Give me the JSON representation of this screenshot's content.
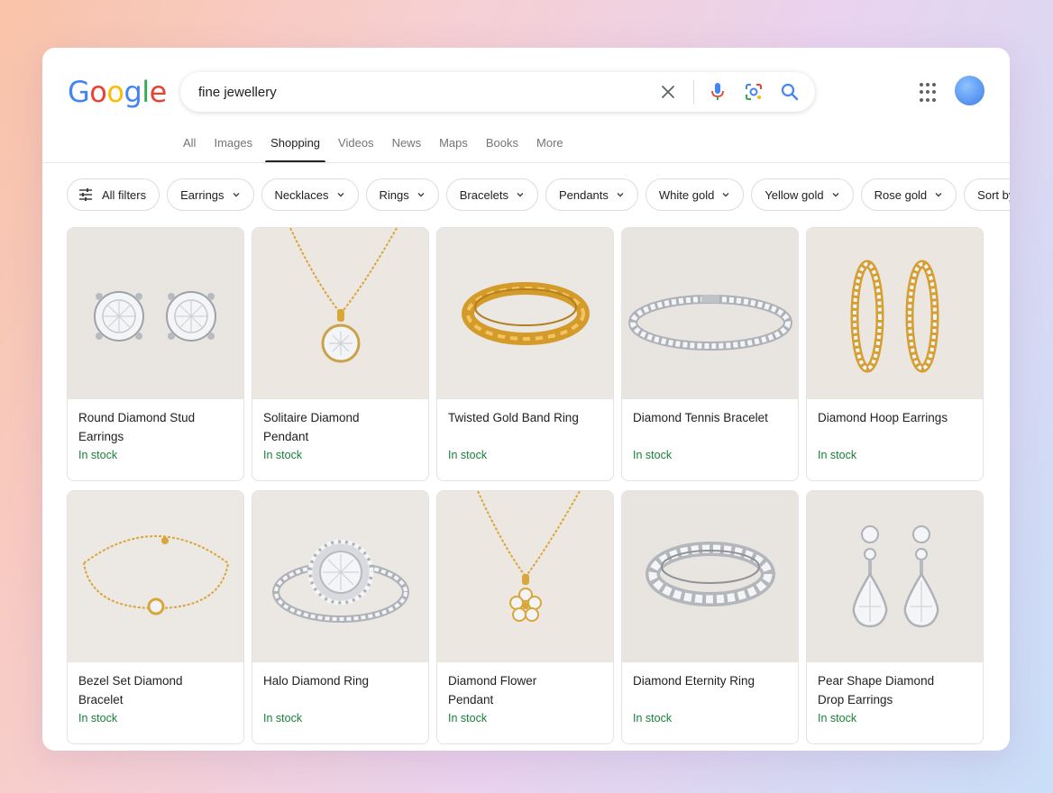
{
  "logo": {
    "letters": [
      "G",
      "o",
      "o",
      "g",
      "l",
      "e"
    ],
    "colors": [
      "#4285F4",
      "#EA4335",
      "#FBBC05",
      "#4285F4",
      "#34A853",
      "#EA4335"
    ]
  },
  "search": {
    "query": "fine jewellery"
  },
  "icons": {
    "clear": "close-icon",
    "voice": "mic-icon",
    "lens": "camera-lens-icon",
    "search": "search-icon",
    "apps": "apps-grid-icon",
    "account": "avatar"
  },
  "tabs": [
    {
      "label": "All"
    },
    {
      "label": "Images"
    },
    {
      "label": "Shopping",
      "active": true
    },
    {
      "label": "Videos"
    },
    {
      "label": "News"
    },
    {
      "label": "Maps"
    },
    {
      "label": "Books"
    },
    {
      "label": "More"
    }
  ],
  "filters": [
    {
      "label": "All filters"
    },
    {
      "label": "Earrings"
    },
    {
      "label": "Necklaces"
    },
    {
      "label": "Rings"
    },
    {
      "label": "Bracelets"
    },
    {
      "label": "Pendants"
    },
    {
      "label": "White gold"
    },
    {
      "label": "Yellow gold"
    },
    {
      "label": "Rose gold"
    },
    {
      "label": "Sort by"
    }
  ],
  "products": [
    {
      "name": "Round Diamond Stud Earrings",
      "stock": "In stock",
      "image": "stud-earrings"
    },
    {
      "name": "Solitaire Diamond Pendant",
      "stock": "In stock",
      "image": "solitaire-pendant"
    },
    {
      "name": "Twisted Gold Band Ring",
      "stock": "In stock",
      "image": "twisted-band"
    },
    {
      "name": "Diamond Tennis Bracelet",
      "stock": "In stock",
      "image": "tennis-bracelet"
    },
    {
      "name": "Diamond Hoop Earrings",
      "stock": "In stock",
      "image": "hoop-earrings"
    },
    {
      "name": "Bezel Set Diamond Bracelet",
      "stock": "In stock",
      "image": "bezel-bracelet"
    },
    {
      "name": "Halo Diamond Ring",
      "stock": "In stock",
      "image": "halo-ring"
    },
    {
      "name": "Diamond Flower Pendant",
      "stock": "In stock",
      "image": "flower-pendant"
    },
    {
      "name": "Diamond Eternity Ring",
      "stock": "In stock",
      "image": "eternity-ring"
    },
    {
      "name": "Pear Shape Diamond Drop Earrings",
      "stock": "In stock",
      "image": "pear-drop-earrings"
    }
  ],
  "colors": {
    "gold": "#d9a63a",
    "silver": "#c9ccd1",
    "stock_green": "#188038"
  }
}
